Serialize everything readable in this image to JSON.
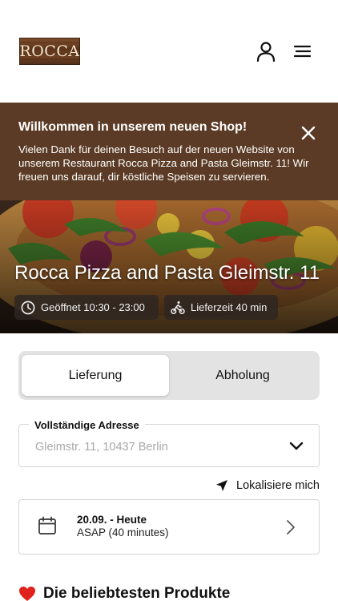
{
  "header": {
    "logo_text": "ROCCA",
    "icons": {
      "user": "user-icon",
      "menu": "hamburger-menu-icon"
    }
  },
  "notice": {
    "title": "Willkommen in unserem neuen Shop!",
    "body": "Vielen Dank für deinen Besuch auf der neuen Website von unserem Restaurant Rocca Pizza and Pasta Gleimstr. 11! Wir freuen uns darauf, dir köstliche Speisen zu servieren.",
    "background": "#5b3b25",
    "close_icon": "close-icon"
  },
  "hero": {
    "title": "Rocca Pizza and Pasta Gleimstr. 11",
    "opening": {
      "icon": "clock-icon",
      "text": "Geöffnet 10:30 - 23:00"
    },
    "delivery": {
      "icon": "delivery-bike-icon",
      "text": "Lieferzeit 40 min"
    }
  },
  "order_mode": {
    "options": [
      "Lieferung",
      "Abholung"
    ],
    "selected": "Lieferung"
  },
  "address": {
    "label": "Vollständige Adresse",
    "placeholder": "Gleimstr. 11, 10437 Berlin",
    "value": ""
  },
  "locate": {
    "icon": "location-arrow-icon",
    "label": "Lokalisiere mich"
  },
  "schedule": {
    "icon": "calendar-icon",
    "date": "20.09. - Heute",
    "time": "ASAP (40 minutes)"
  },
  "popular": {
    "icon": "heart-icon",
    "title": "Die beliebtesten Produkte"
  },
  "colors": {
    "brand_brown": "#5b3b25",
    "toggle_bg": "#e3e3e3",
    "border": "#d6d6d6"
  }
}
